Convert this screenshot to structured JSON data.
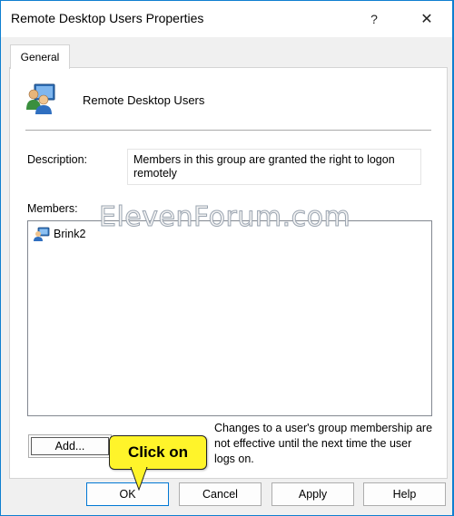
{
  "window": {
    "title": "Remote Desktop Users Properties",
    "help_glyph": "?",
    "close_glyph": "✕"
  },
  "tabs": [
    {
      "label": "General",
      "selected": true
    }
  ],
  "group": {
    "name": "Remote Desktop Users",
    "icon": "user-group-icon"
  },
  "description": {
    "label": "Description:",
    "value": "Members in this group are granted the right to logon remotely"
  },
  "members": {
    "label": "Members:",
    "items": [
      {
        "name": "Brink2",
        "icon": "user-account-icon"
      }
    ]
  },
  "add_button": {
    "label": "Add..."
  },
  "add_note": "Changes to a user's group membership are not effective until the next time the user logs on.",
  "buttons": {
    "ok": "OK",
    "cancel": "Cancel",
    "apply": "Apply",
    "help": "Help"
  },
  "watermark": "ElevenForum.com",
  "callout": {
    "text": "Click on",
    "color": "#fff42a"
  },
  "colors": {
    "desktop": "#0f7fd0",
    "accent": "#0078d4"
  }
}
